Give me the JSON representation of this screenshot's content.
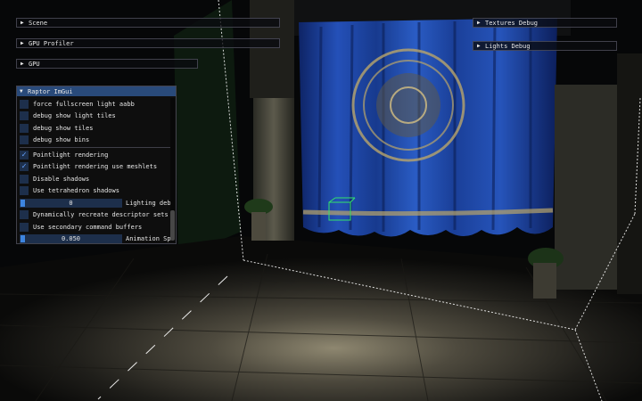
{
  "windows": {
    "scene": {
      "label": "Scene"
    },
    "gpu_profiler": {
      "label": "GPU Profiler"
    },
    "gpu": {
      "label": "GPU"
    },
    "textures_debug": {
      "label": "Textures Debug"
    },
    "lights_debug": {
      "label": "Lights Debug"
    }
  },
  "panel": {
    "title": "Raptor ImGui",
    "checkboxes_top": [
      {
        "label": "force fullscreen light aabb",
        "checked": false
      },
      {
        "label": "debug show light tiles",
        "checked": false
      },
      {
        "label": "debug show tiles",
        "checked": false
      },
      {
        "label": "debug show bins",
        "checked": false
      }
    ],
    "checkboxes_mid": [
      {
        "label": "Pointlight rendering",
        "checked": true
      },
      {
        "label": "Pointlight rendering use meshlets",
        "checked": true
      },
      {
        "label": "Disable shadows",
        "checked": false
      },
      {
        "label": "Use tetrahedron shadows",
        "checked": false
      }
    ],
    "lighting_slider": {
      "value": "0",
      "label": "Lighting deb"
    },
    "checkboxes_bottom": [
      {
        "label": "Dynamically recreate descriptor sets",
        "checked": false
      },
      {
        "label": "Use secondary command buffers",
        "checked": false
      }
    ],
    "animation_slider": {
      "value": "0.050",
      "label": "Animation Sp"
    }
  },
  "colors": {
    "title_bar": "#294a7a",
    "checkbox_bg": "#1d2f4b",
    "check_mark": "#66a3ff",
    "slider_grab": "#3d85e0",
    "curtain": "#1c3f9a"
  }
}
